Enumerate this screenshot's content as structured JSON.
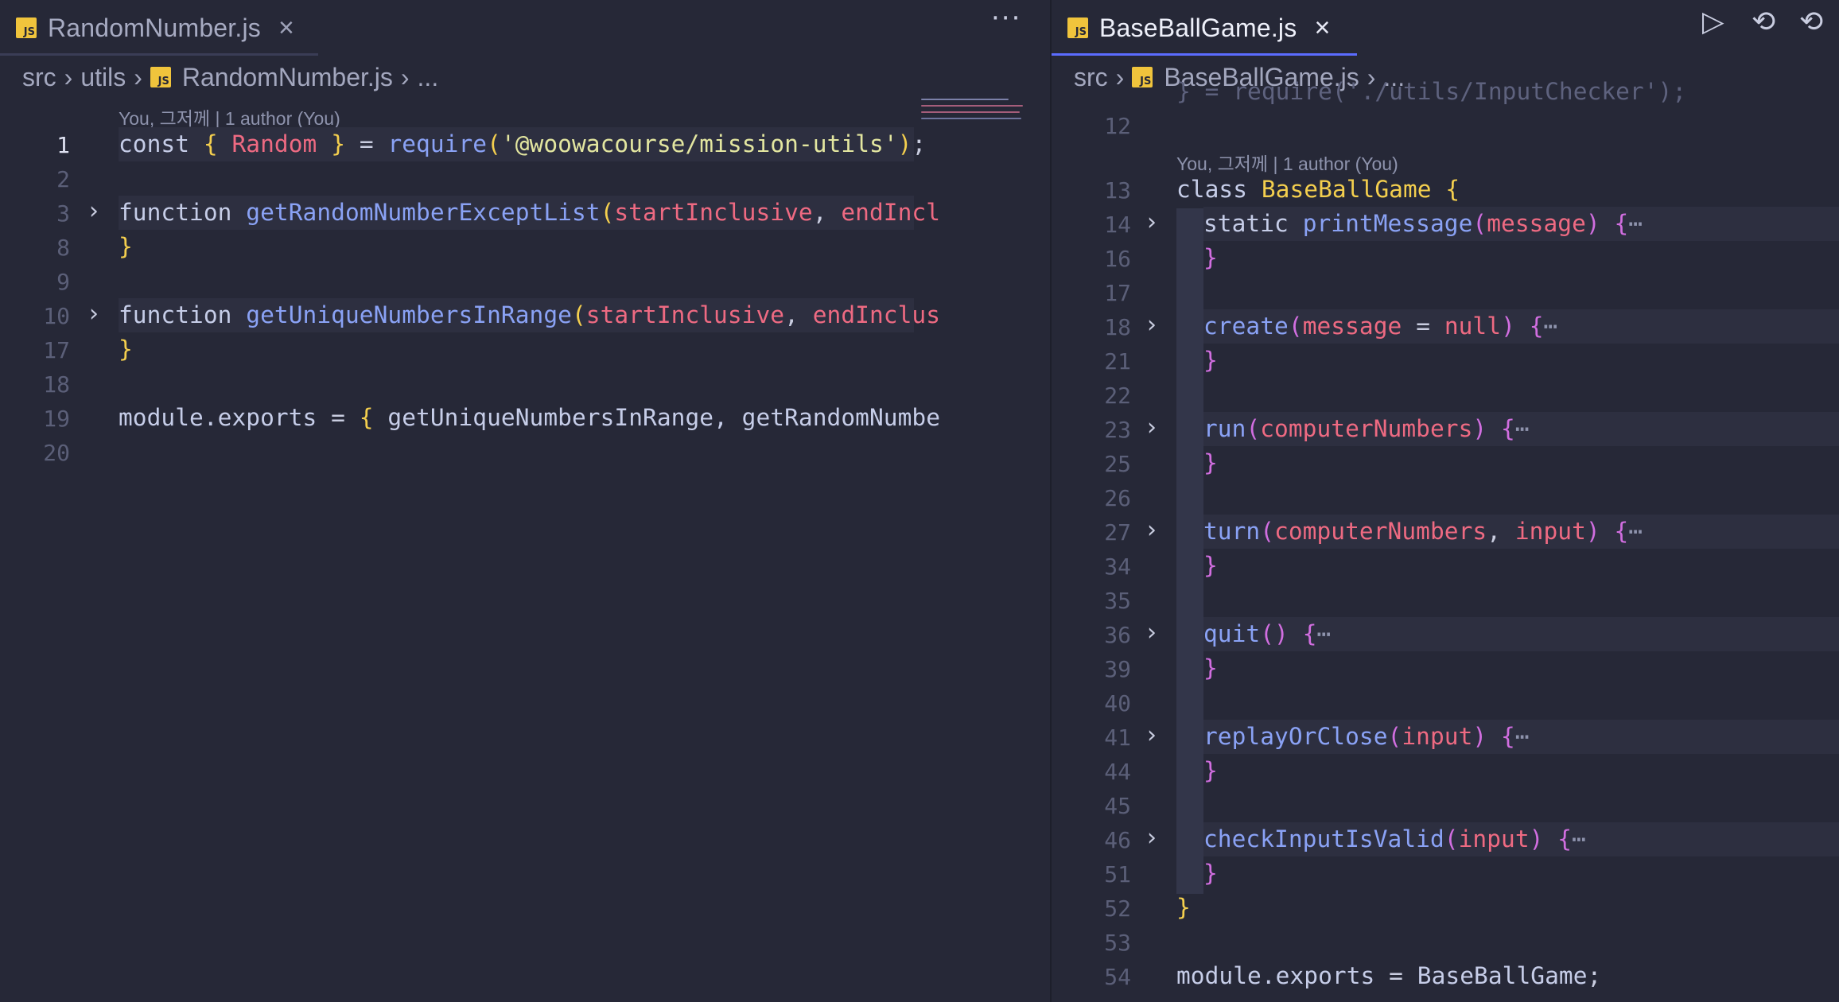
{
  "left_pane": {
    "tab": {
      "label": "RandomNumber.js",
      "icon": "js-icon",
      "close": "×"
    },
    "more_actions": "···",
    "breadcrumb": {
      "segments": [
        "src",
        "utils",
        "RandomNumber.js",
        "..."
      ]
    },
    "codelens": "You, 그저께 | 1 author (You)",
    "lines": [
      {
        "number": "1",
        "active": true
      },
      {
        "number": "2"
      },
      {
        "number": "3",
        "folded": true
      },
      {
        "number": "8"
      },
      {
        "number": "9"
      },
      {
        "number": "10",
        "folded": true
      },
      {
        "number": "17"
      },
      {
        "number": "18"
      },
      {
        "number": "19"
      },
      {
        "number": "20"
      }
    ],
    "code": {
      "l1": {
        "kw": "const",
        "b1": "{",
        "id": "Random",
        "b2": "}",
        "op": "=",
        "fn": "require",
        "p1": "(",
        "str": "'@woowacourse/mission-utils'",
        "p2": ")",
        "end": ";"
      },
      "l3": {
        "kw": "function",
        "fn": "getRandomNumberExceptList",
        "p": "(",
        "a1": "startInclusive",
        "c": ",",
        "a2": "endIncl"
      },
      "l8": {
        "b": "}"
      },
      "l10": {
        "kw": "function",
        "fn": "getUniqueNumbersInRange",
        "p": "(",
        "a1": "startInclusive",
        "c": ",",
        "a2": "endInclus"
      },
      "l17": {
        "b": "}"
      },
      "l19": {
        "id": "module.exports",
        "op": "=",
        "b": "{",
        "rest": "getUniqueNumbersInRange, getRandomNumbe"
      }
    }
  },
  "right_pane": {
    "tab": {
      "label": "BaseBallGame.js",
      "icon": "js-icon",
      "close": "×"
    },
    "toolbar": {
      "run": "▷",
      "timeline": "⟲",
      "revert": "⟲"
    },
    "breadcrumb": {
      "segments": [
        "src",
        "BaseBallGame.js",
        "..."
      ]
    },
    "partial_top": "} = require('./utils/InputChecker');",
    "codelens": "You, 그저께 | 1 author (You)",
    "lines": [
      {
        "number": "12"
      },
      {
        "number": "13"
      },
      {
        "number": "14",
        "folded": true
      },
      {
        "number": "16"
      },
      {
        "number": "17"
      },
      {
        "number": "18",
        "folded": true
      },
      {
        "number": "21"
      },
      {
        "number": "22"
      },
      {
        "number": "23",
        "folded": true
      },
      {
        "number": "25"
      },
      {
        "number": "26"
      },
      {
        "number": "27",
        "folded": true
      },
      {
        "number": "34"
      },
      {
        "number": "35"
      },
      {
        "number": "36",
        "folded": true
      },
      {
        "number": "39"
      },
      {
        "number": "40"
      },
      {
        "number": "41",
        "folded": true
      },
      {
        "number": "44"
      },
      {
        "number": "45"
      },
      {
        "number": "46",
        "folded": true
      },
      {
        "number": "51"
      },
      {
        "number": "52"
      },
      {
        "number": "53"
      },
      {
        "number": "54"
      }
    ],
    "code": {
      "l13": {
        "kw": "class",
        "cl": "BaseBallGame",
        "b": "{"
      },
      "l14": {
        "kw": "static",
        "fn": "printMessage",
        "p1": "(",
        "a": "message",
        "p2": ")",
        "b": "{",
        "ell": "⋯"
      },
      "l18": {
        "fn": "create",
        "p1": "(",
        "a": "message",
        "op": "=",
        "lit": "null",
        "p2": ")",
        "b": "{",
        "ell": "⋯"
      },
      "l23": {
        "fn": "run",
        "p1": "(",
        "a": "computerNumbers",
        "p2": ")",
        "b": "{",
        "ell": "⋯"
      },
      "l27": {
        "fn": "turn",
        "p1": "(",
        "a1": "computerNumbers",
        "c": ",",
        "a2": "input",
        "p2": ")",
        "b": "{",
        "ell": "⋯"
      },
      "l36": {
        "fn": "quit",
        "p": "()",
        "b": "{",
        "ell": "⋯"
      },
      "l41": {
        "fn": "replayOrClose",
        "p1": "(",
        "a": "input",
        "p2": ")",
        "b": "{",
        "ell": "⋯"
      },
      "l46": {
        "fn": "checkInputIsValid",
        "p1": "(",
        "a": "input",
        "p2": ")",
        "b": "{",
        "ell": "⋯"
      },
      "close_inner": "}",
      "l52": {
        "b": "}"
      },
      "l54": {
        "id": "module.exports",
        "op": "=",
        "val": "BaseBallGame",
        "end": ";"
      }
    }
  },
  "colors": {
    "background": "#262837",
    "keyword": "#c6cde8",
    "function": "#8aa2f5",
    "parameter": "#ee6a82",
    "bracket": "#f4cf4e",
    "string": "#e3e6a0",
    "active_tab_underline": "#5b6cff"
  }
}
